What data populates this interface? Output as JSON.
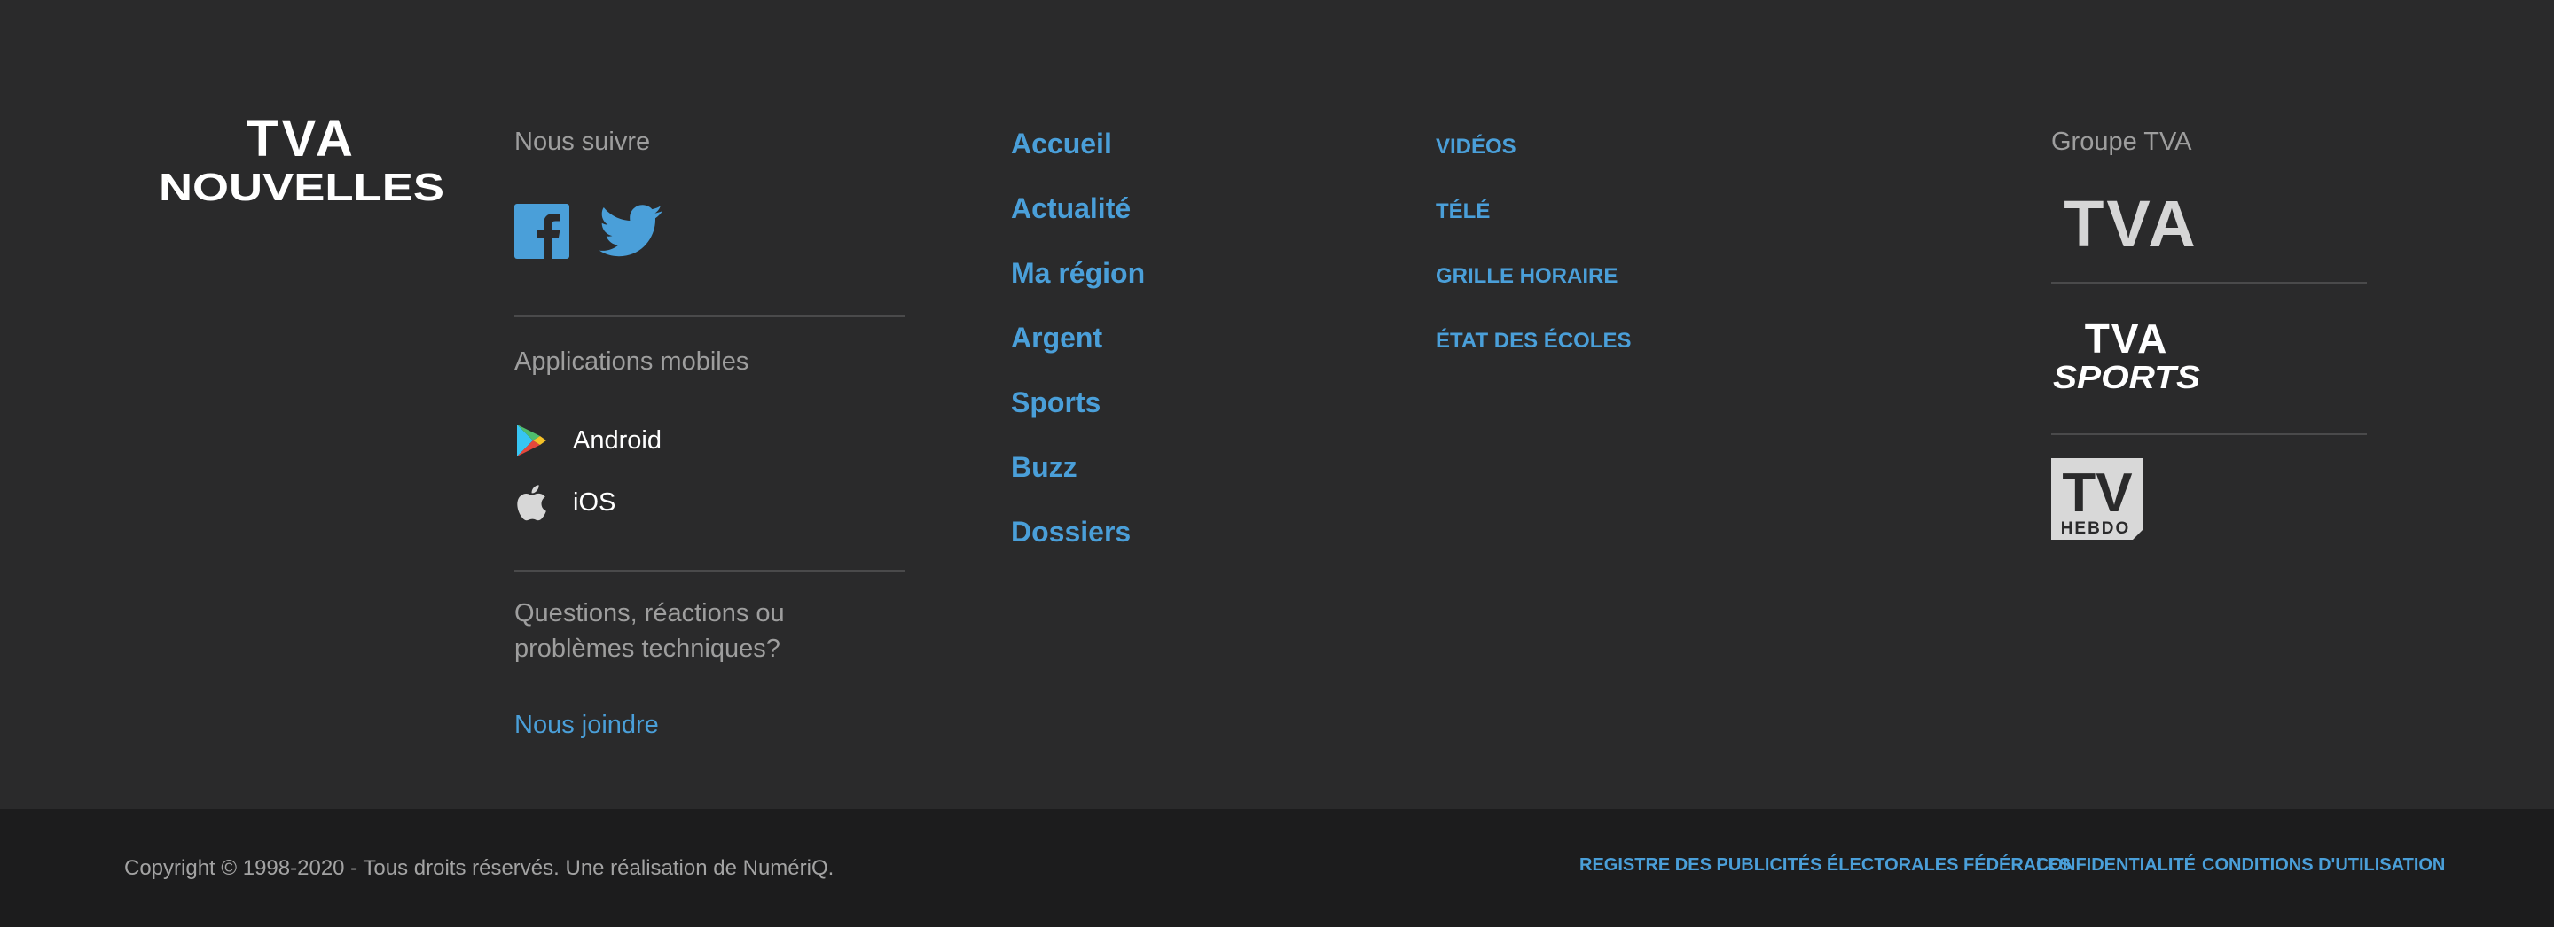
{
  "brand": {
    "logo_top": "TVA",
    "logo_bottom": "NOUVELLES"
  },
  "follow": {
    "heading": "Nous suivre",
    "facebook_icon": "facebook-icon",
    "twitter_icon": "twitter-icon"
  },
  "apps": {
    "heading": "Applications mobiles",
    "items": [
      {
        "label": "Android",
        "icon": "google-play-icon"
      },
      {
        "label": "iOS",
        "icon": "apple-icon"
      }
    ]
  },
  "support": {
    "question": "Questions, réactions ou problèmes techniques?",
    "contact_label": "Nous joindre"
  },
  "nav": {
    "items": [
      "Accueil",
      "Actualité",
      "Ma région",
      "Argent",
      "Sports",
      "Buzz",
      "Dossiers"
    ]
  },
  "subnav": {
    "items": [
      "VIDÉOS",
      "TÉLÉ",
      "GRILLE HORAIRE",
      "ÉTAT DES ÉCOLES"
    ]
  },
  "group": {
    "heading": "Groupe TVA",
    "brands": [
      {
        "name": "TVA",
        "icon": "tva-logo"
      },
      {
        "name": "TVA SPORTS",
        "line1": "TVA",
        "line2": "SPORTS",
        "icon": "tva-sports-logo"
      },
      {
        "name": "TV HEBDO",
        "line1": "TV",
        "line2": "HEBDO",
        "icon": "tv-hebdo-logo"
      }
    ]
  },
  "bottom": {
    "copyright": "Copyright © 1998-2020 - Tous droits réservés. Une réalisation de NumériQ.",
    "links": [
      "REGISTRE DES PUBLICITÉS ÉLECTORALES FÉDÉRALES",
      "CONFIDENTIALITÉ",
      "CONDITIONS D'UTILISATION"
    ]
  },
  "colors": {
    "background": "#2a2a2b",
    "bottom_bar": "#1c1c1d",
    "link": "#4a9fd9",
    "muted_text": "#9e9e9e",
    "divider": "#4a4a4b"
  }
}
